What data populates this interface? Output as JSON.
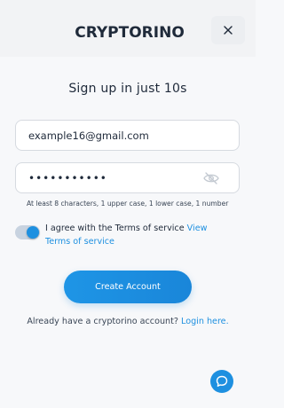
{
  "brand": {
    "name": "CRYPTORINO",
    "color": "#1f2a3a",
    "accent": "#1e90e0"
  },
  "header": {
    "close_icon": "close-icon"
  },
  "title": "Sign up in just 10s",
  "email": {
    "value": "example16@gmail.com"
  },
  "password": {
    "masked_value": "•••••••••••",
    "toggle_icon": "eye-slash-icon",
    "hint": "At least 8 characters, 1 upper case, 1 lower case, 1 number"
  },
  "terms": {
    "agreed": true,
    "text": "I agree with the Terms of service",
    "link": "View Terms of service"
  },
  "create_button": "Create Account",
  "login": {
    "text": "Already have a cryptorino account?",
    "link": "Login here."
  },
  "chat_icon": "chat-bubble-icon"
}
